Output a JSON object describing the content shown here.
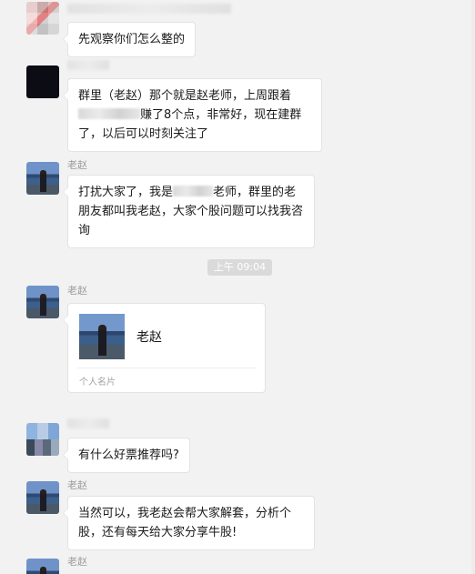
{
  "messages": [
    {
      "sender": "",
      "text": "先观察你们怎么整的"
    },
    {
      "sender": "",
      "text_before": "群里（老赵）那个就是赵老师，上周跟着",
      "text_after": "赚了8个点，非常好，现在建群了，以后可以时刻关注了"
    },
    {
      "sender": "老赵",
      "text_before": "打扰大家了，我是",
      "text_after": "老师，群里的老朋友都叫我老赵，大家个股问题可以找我咨询"
    },
    {
      "sender": "老赵"
    },
    {
      "sender": "",
      "text": "有什么好票推荐吗?"
    },
    {
      "sender": "老赵",
      "text": "当然可以，我老赵会帮大家解套，分析个股，还有每天给大家分享牛股!"
    },
    {
      "sender": "老赵"
    }
  ],
  "timestamp": "上午 09:04",
  "contact_card": {
    "name": "老赵",
    "type_label": "个人名片"
  }
}
